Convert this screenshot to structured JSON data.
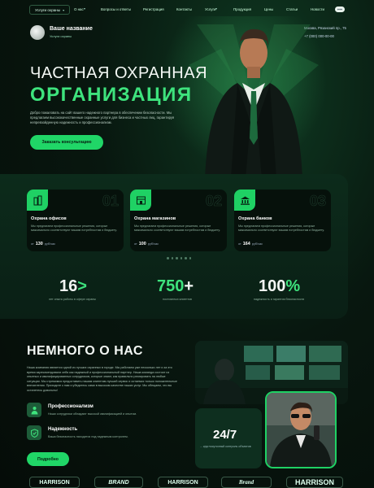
{
  "nav": {
    "services": "Услуги охраны",
    "links": [
      "О нас",
      "Вопросы и ответы",
      "Регистрация",
      "Контакты",
      "Услуги",
      "Продукция",
      "Цены",
      "Статьи",
      "Новости"
    ],
    "search": "+++"
  },
  "brand": {
    "name": "Ваше название",
    "sub": "Услуги охраны"
  },
  "contact": {
    "address": "Москва, Рязанский пр., 75",
    "phone": "+7 (000) 000-00-00"
  },
  "hero": {
    "title_line1": "ЧАСТНАЯ ОХРАННАЯ",
    "title_line2": "ОРГАНИЗАЦИЯ",
    "desc": "Добро пожаловать на сайт вашего надежного партнера в обеспечении безопасности. Мы предлагаем высококачественные охранные услуги для бизнеса и частных лиц, гарантируя непревзойденную надежность и профессионализм.",
    "cta": "Заказать консультацию"
  },
  "services": [
    {
      "num": "01",
      "title": "Охрана офисов",
      "text": "Мы предлагаем профессиональные решения, которые максимально соответствуют вашим потребностям и бюджету.",
      "price_from": "от",
      "price": "130",
      "unit": "руб/час"
    },
    {
      "num": "02",
      "title": "Охрана магазинов",
      "text": "Мы предлагаем профессиональные решения, которые максимально соответствуют вашим потребностям и бюджету.",
      "price_from": "от",
      "price": "100",
      "unit": "руб/час"
    },
    {
      "num": "03",
      "title": "Охрана банков",
      "text": "Мы предлагаем профессиональные решения, которые максимально соответствуют вашим потребностям и бюджету.",
      "price_from": "от",
      "price": "164",
      "unit": "руб/час"
    }
  ],
  "stats": [
    {
      "value": "16",
      "suffix": ">",
      "label": "лет опыта работы в сфере охраны"
    },
    {
      "value": "750",
      "suffix": "+",
      "label": "постоянных клиентов"
    },
    {
      "value": "100",
      "suffix": "%",
      "label": "надежность и гарантия безопасности"
    }
  ],
  "about": {
    "title": "НЕМНОГО О НАС",
    "text": "Наша компания является одной из лучших охранных в городе. Мы работаем уже несколько лет и за это время зарекомендовали себя как надежный и профессиональный партнер. Наша команда состоит из опытных и квалифицированных сотрудников, которые знают, как правильно реагировать на любые ситуации. Мы стремимся предоставить нашим клиентам лучший сервис и остаемся только положительные впечатления. Приходите к нам и убедитесь сами в высоком качестве наших услуг. Мы обещаем, что вы останетесь довольны!",
    "features": [
      {
        "title": "Профессионализм",
        "text": "Наши сотрудники обладают высокой квалификацией и опытом."
      },
      {
        "title": "Надежность",
        "text": "Ваша безопасность находится под надежным контролем."
      }
    ],
    "more": "Подробно",
    "box_value": "24/7",
    "box_label": "... круглосуточный контроль объектов"
  },
  "partners": [
    "HARRISON",
    "BRAND",
    "HARRISON",
    "Brand",
    "HARRISON"
  ],
  "colors": {
    "accent": "#20d667",
    "bg": "#07120d"
  }
}
